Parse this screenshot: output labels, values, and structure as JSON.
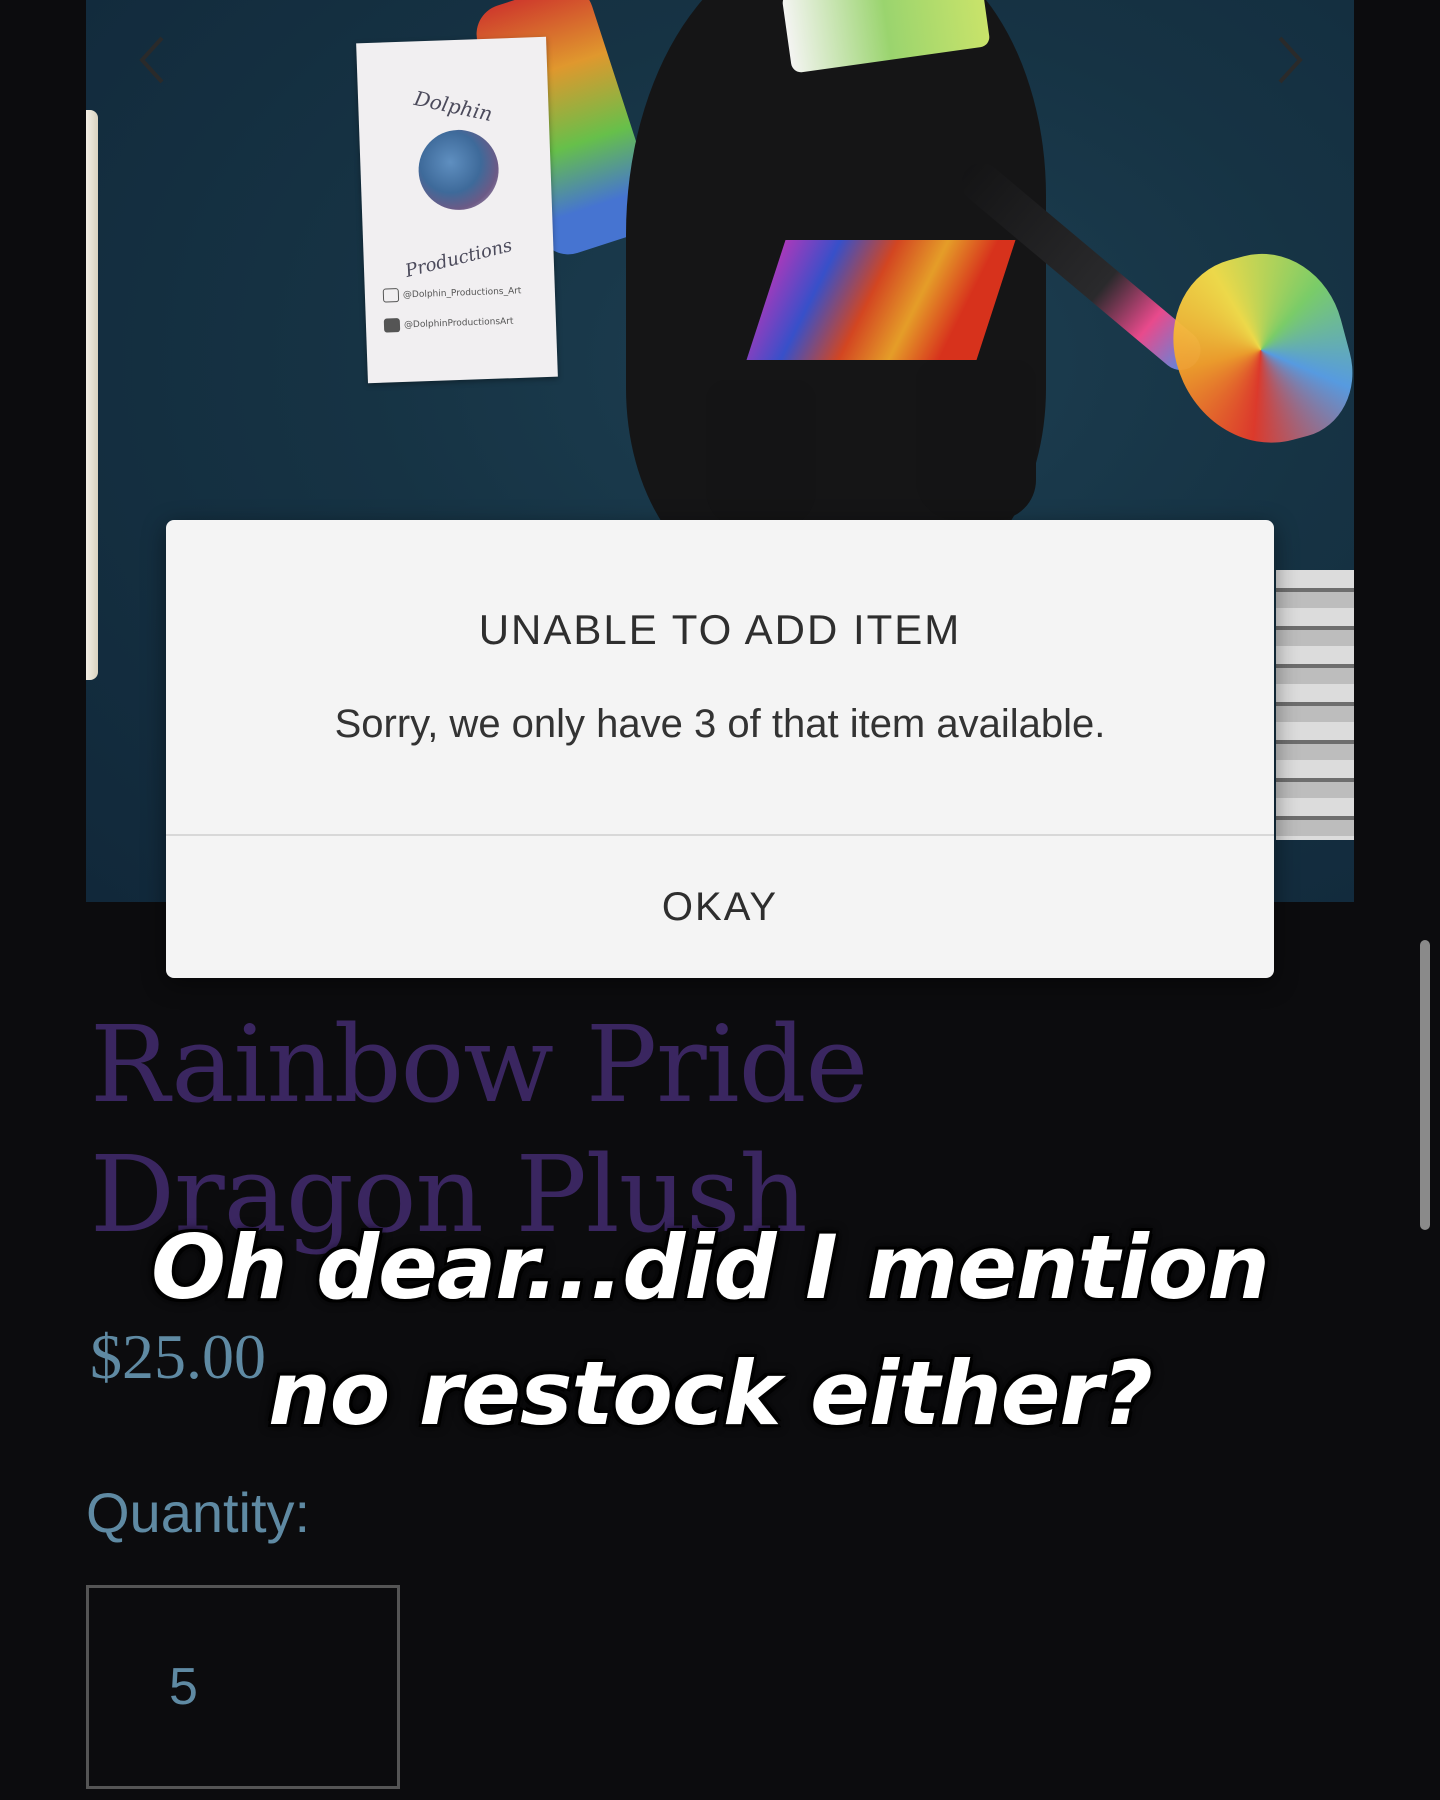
{
  "gallery": {
    "prev_icon": "chevron-left-icon",
    "next_icon": "chevron-right-icon",
    "tag_brand": "Dolphin",
    "tag_brand_sub": "Productions",
    "tag_instagram": "@Dolphin_Productions_Art",
    "tag_youtube": "@DolphinProductionsArt"
  },
  "product": {
    "title": "Rainbow Pride Dragon Plush",
    "price": "$25.00",
    "quantity_label": "Quantity:",
    "quantity_value": "5"
  },
  "modal": {
    "title": "UNABLE TO ADD ITEM",
    "message": "Sorry, we only have 3 of that item available.",
    "button_label": "OKAY"
  },
  "caption": {
    "line1": "Oh dear...did I mention",
    "line2": "no restock either?"
  },
  "colors": {
    "background": "#0c0c0e",
    "title": "#3a2660",
    "price": "#5f8aa3",
    "modal_bg": "#f4f4f4"
  }
}
